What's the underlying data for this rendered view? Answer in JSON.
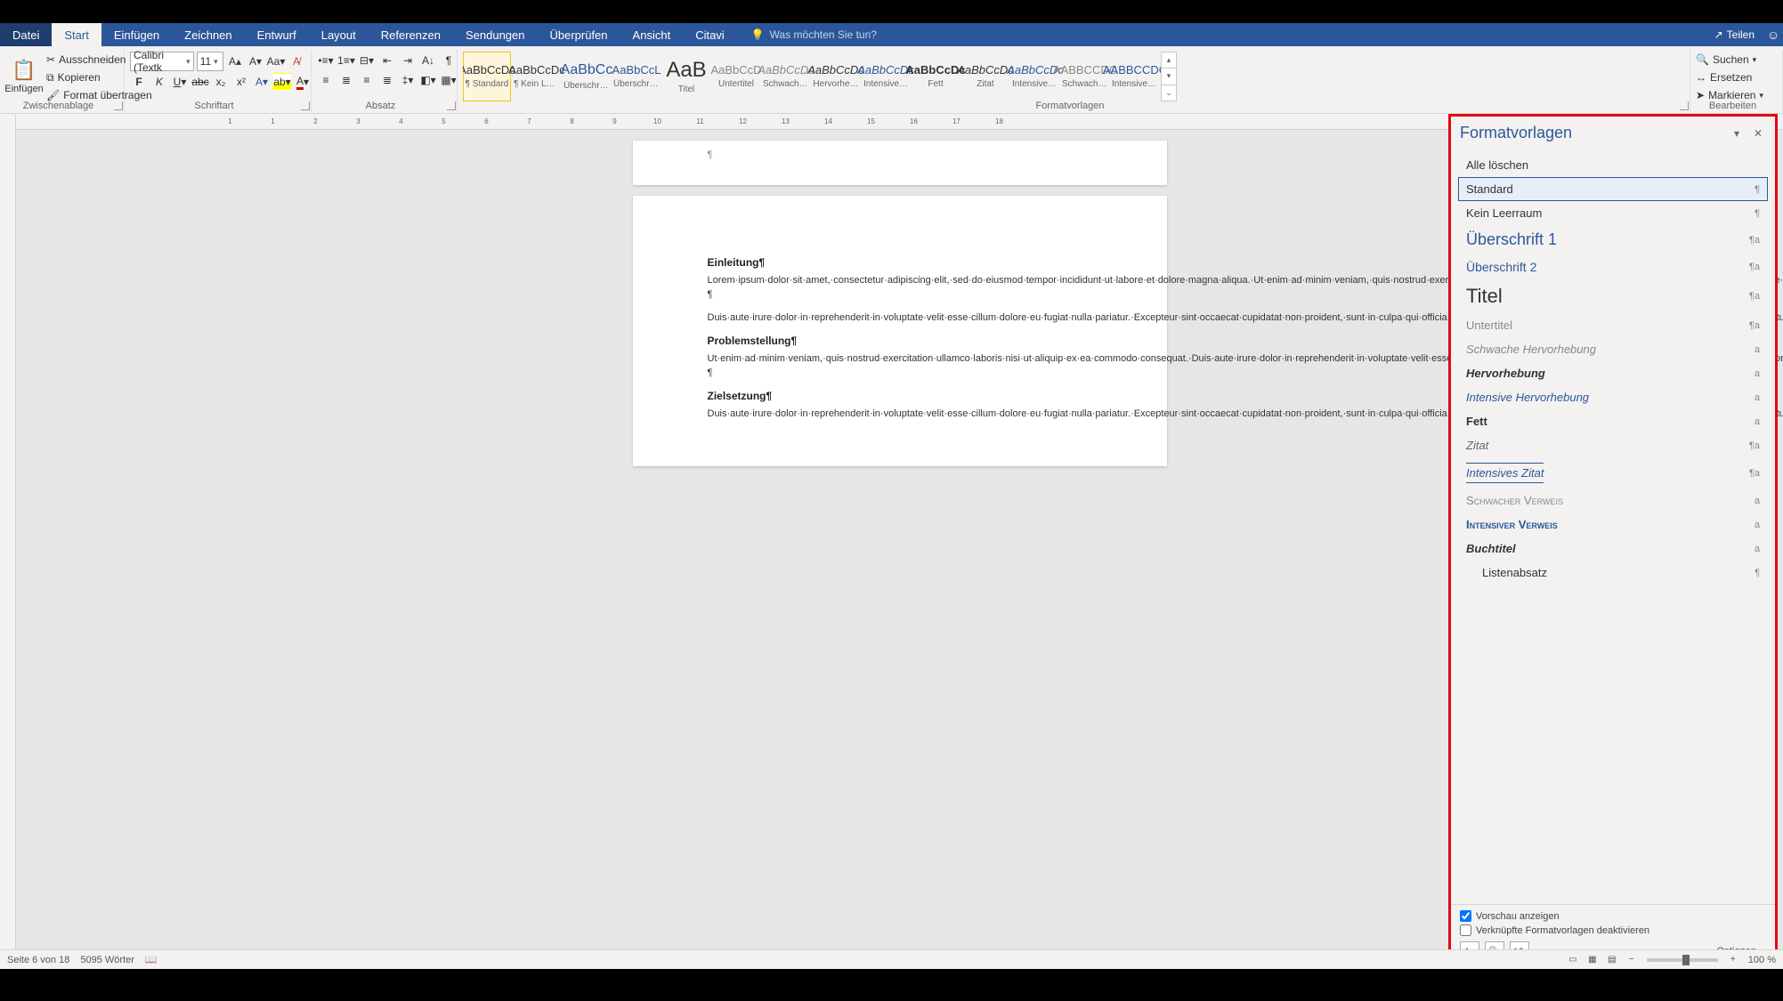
{
  "titlebar": {
    "tabs": [
      "Datei",
      "Start",
      "Einfügen",
      "Zeichnen",
      "Entwurf",
      "Layout",
      "Referenzen",
      "Sendungen",
      "Überprüfen",
      "Ansicht",
      "Citavi"
    ],
    "tellme": "Was möchten Sie tun?",
    "share": "Teilen"
  },
  "ribbon": {
    "clipboard": {
      "paste": "Einfügen",
      "cut": "Ausschneiden",
      "copy": "Kopieren",
      "format": "Format übertragen",
      "label": "Zwischenablage"
    },
    "font": {
      "name": "Calibri (Textk",
      "size": "11",
      "label": "Schriftart"
    },
    "paragraph": {
      "label": "Absatz"
    },
    "styles": {
      "label": "Formatvorlagen",
      "items": [
        {
          "prev": "AaBbCcDc",
          "lbl": "¶ Standard",
          "sel": true
        },
        {
          "prev": "AaBbCcDc",
          "lbl": "¶ Kein Lee…"
        },
        {
          "prev": "AaBbCc",
          "lbl": "Überschrif…",
          "blue": true,
          "big": true
        },
        {
          "prev": "AaBbCcL",
          "lbl": "Überschrif…",
          "blue": true
        },
        {
          "prev": "AaB",
          "lbl": "Titel",
          "huge": true
        },
        {
          "prev": "AaBbCcD",
          "lbl": "Untertitel",
          "gray": true
        },
        {
          "prev": "AaBbCcDc",
          "lbl": "Schwache…",
          "ital": true,
          "gray": true
        },
        {
          "prev": "AaBbCcDc",
          "lbl": "Hervorhe…",
          "ital": true
        },
        {
          "prev": "AaBbCcDc",
          "lbl": "Intensive…",
          "ital": true,
          "blue": true
        },
        {
          "prev": "AaBbCcDc",
          "lbl": "Fett",
          "bold": true
        },
        {
          "prev": "AaBbCcDc",
          "lbl": "Zitat",
          "ital": true
        },
        {
          "prev": "AaBbCcDc",
          "lbl": "Intensives…",
          "ital": true,
          "blue": true
        },
        {
          "prev": "AABBCCDC",
          "lbl": "Schwache…",
          "gray": true
        },
        {
          "prev": "AABBCCDC",
          "lbl": "Intensiver…",
          "blue": true
        }
      ]
    },
    "editing": {
      "find": "Suchen",
      "replace": "Ersetzen",
      "select": "Markieren",
      "label": "Bearbeiten"
    }
  },
  "doc": {
    "h1": "Einleitung¶",
    "p1": "Lorem·ipsum·dolor·sit·amet,·consectetur·adipiscing·elit,·sed·do·eiusmod·tempor·incididunt·ut·labore·et·dolore·magna·aliqua.·Ut·enim·ad·minim·veniam,·quis·nostrud·exercitation·ullamco·laboris·nisi·ut·aliquip·ex·ea·commodo·consequat.·Duis·aute·irure·dolor·in·reprehenderit·in·voluptate·velit·esse·cillum·dolore·eu·fugiat·nulla·pariatur.·Excepteur·sint·occaecat·cupidatat·non·proident,·sunt·in·culpa·qui·officia·deserunt·mollit·anim·id·est·laborum.·Lorem·ipsum·dolor·sit·amet,·consectetur·adipiscing·elit,·sed·do·eiusmod·tempor·incididunt·ut·labore·et·dolore·magna·aliqua.·Ut·enim·ad·minim·veniam,·quis·nostrud·exercitation·ullamco·laboris·nisi·ut·aliquip·ex·ea·commodo·consequat. ¶",
    "p2": "Duis·aute·irure·dolor·in·reprehenderit·in·voluptate·velit·esse·cillum·dolore·eu·fugiat·nulla·pariatur.·Excepteur·sint·occaecat·cupidatat·non·proident,·sunt·in·culpa·qui·officia·deserunt·mollit·anim·id·est·laborum.·Lorem·ipsum·dolor·sit·amet,·consectetur·adipiscing·elit,·sed·do·eiusmod·tempor·incididunt·ut·labore·et·dolore·magna·aliqua.·Ut·enim·ad·minim·veniam,·quis·nostrud·exercitation·ullamco·laboris·nisi·ut·aliquip·ex·ea·commodo·consequat.·¶",
    "h2": "Problemstellung¶",
    "p3": "Ut·enim·ad·minim·veniam,·quis·nostrud·exercitation·ullamco·laboris·nisi·ut·aliquip·ex·ea·commodo·consequat.·Duis·aute·irure·dolor·in·reprehenderit·in·voluptate·velit·esse·cillum·dolore·eu·fugiat·nulla·pariatur.·Excepteur·sint·occaecat·cupidatat·non·proident,·sunt·in·culpa·qui·officia·deserunt·mollit·anim·id·est·laborum.·Lorem·ipsum·dolor·sit·amet,·consectetur·adipiscing·elit,·sed·do·eiusmod·tempor·incididunt·ut·labore·et·dolore·magna·aliqua.·Ut·enim·ad·minim·veniam,·quis·nostrud·exercitation·ullamco·laboris·nisi·ut·aliquip·ex·ea·commodo·consequat.·Duis·aute·irure·dolor·in·reprehenderit·in·voluptate·velit·esse·cillum·dolore·eu·fugiat·nulla·pariatur.·Excepteur·sint·occaecat·cupidatat·non·proident,·sunt·in·culpa·qui·officia·deserunt·mollit·anim·id·est·laborum.·Lorem·ipsum·dolor·sit·amet,·consectetur·adipiscing·elit,·sed·do·eiusmod·tempor·incididunt·ut·labore·et·dolore·magna·aliqua. ¶",
    "h3": "Zielsetzung¶",
    "p4": "Duis·aute·irure·dolor·in·reprehenderit·in·voluptate·velit·esse·cillum·dolore·eu·fugiat·nulla·pariatur.·Excepteur·sint·occaecat·cupidatat·non·proident,·sunt·in·culpa·qui·officia·deserunt·mollit·anim·id·est·laborum.·Lorem·ipsum·dolor·sit·amet,·consectetur·adipiscing·elit,·sed·do·eiusmod·tempor·incididunt·ut·labore·et·dolore·magna·aliqua.·Ut·enim·ad·minim·veniam,·quis·nostrud·exercitation·ullamco·laboris·nisi·ut·aliquip·ex·ea·commodo·consequat.·Duis·aute·irure·dolor·in·reprehenderit·in·voluptate·velit·esse·cillum·dolore·eu·fugiat·nulla·pariatur.·Excepteur·sint·occaecat·cupidatat·non·"
  },
  "stylespane": {
    "title": "Formatvorlagen",
    "clearall": "Alle löschen",
    "items": [
      {
        "nm": "Standard",
        "mk": "¶",
        "sel": true
      },
      {
        "nm": "Kein Leerraum",
        "mk": "¶"
      },
      {
        "nm": "Überschrift 1",
        "mk": "¶a",
        "css": "font-size:18px;color:#2b579a;"
      },
      {
        "nm": "Überschrift 2",
        "mk": "¶a",
        "css": "font-size:14px;color:#2b579a;"
      },
      {
        "nm": "Titel",
        "mk": "¶a",
        "css": "font-size:22px;"
      },
      {
        "nm": "Untertitel",
        "mk": "¶a",
        "css": "color:#888;"
      },
      {
        "nm": "Schwache Hervorhebung",
        "mk": "a",
        "css": "font-style:italic;color:#888;"
      },
      {
        "nm": "Hervorhebung",
        "mk": "a",
        "css": "font-style:italic;font-weight:bold;"
      },
      {
        "nm": "Intensive Hervorhebung",
        "mk": "a",
        "css": "font-style:italic;color:#2b579a;"
      },
      {
        "nm": "Fett",
        "mk": "a",
        "css": "font-weight:bold;"
      },
      {
        "nm": "Zitat",
        "mk": "¶a",
        "css": "font-style:italic;text-align:center;display:block;color:#666;"
      },
      {
        "nm": "Intensives Zitat",
        "mk": "¶a",
        "css": "font-style:italic;text-align:center;display:block;color:#2b579a;border-top:1px solid #2b579a;border-bottom:1px solid #2b579a;padding:3px 0;"
      },
      {
        "nm": "Schwacher Verweis",
        "mk": "a",
        "css": "font-variant:small-caps;color:#888;"
      },
      {
        "nm": "Intensiver Verweis",
        "mk": "a",
        "css": "font-variant:small-caps;color:#2b579a;font-weight:bold;"
      },
      {
        "nm": "Buchtitel",
        "mk": "a",
        "css": "font-style:italic;font-weight:bold;"
      },
      {
        "nm": "Listenabsatz",
        "mk": "¶",
        "css": "padding-left:18px;"
      }
    ],
    "showpreview": "Vorschau anzeigen",
    "disablelinked": "Verknüpfte Formatvorlagen deaktivieren",
    "options": "Optionen…"
  },
  "statusbar": {
    "page": "Seite 6 von 18",
    "words": "5095 Wörter",
    "zoom": "100 %"
  },
  "ruler": [
    "1",
    "",
    "1",
    "",
    "2",
    "",
    "3",
    "",
    "4",
    "",
    "5",
    "",
    "6",
    "",
    "7",
    "",
    "8",
    "",
    "9",
    "",
    "10",
    "",
    "11",
    "",
    "12",
    "",
    "13",
    "",
    "14",
    "",
    "15",
    "",
    "16",
    "",
    "17",
    "",
    "18"
  ]
}
